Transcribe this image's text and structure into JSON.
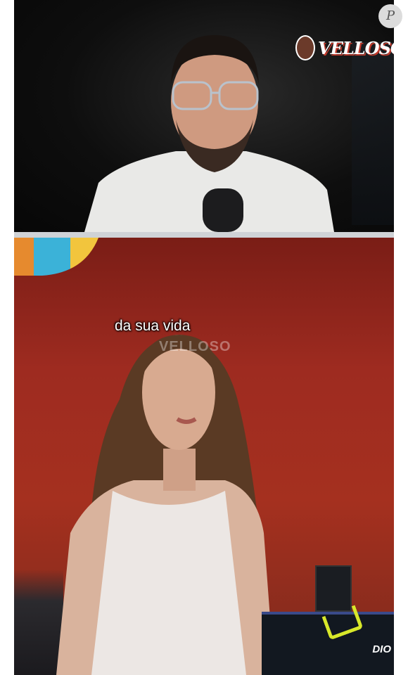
{
  "top_panel": {
    "logo_text": "VELLOSO",
    "corner_badge": "P"
  },
  "bottom_panel": {
    "caption": "da sua vida",
    "watermark": "VELLOSO",
    "table_tag": "DIO"
  }
}
